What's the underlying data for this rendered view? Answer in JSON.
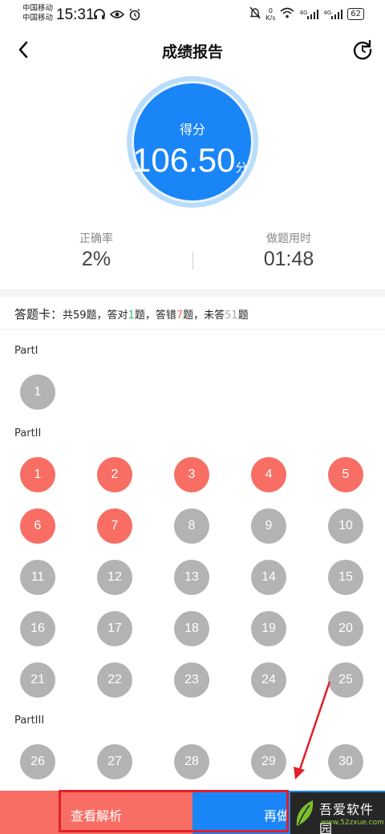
{
  "status_bar": {
    "carrier_1": "中国移动",
    "carrier_2": "中国移动",
    "time": "15:31",
    "speed_value": "0",
    "speed_unit": "K/s",
    "signal_1": "4G",
    "signal_2": "4G",
    "battery": "62"
  },
  "header": {
    "title": "成绩报告",
    "back_icon": "chevron-left-icon",
    "refresh_icon": "redo-icon"
  },
  "score": {
    "label": "得分",
    "value": "106.50",
    "unit": "分"
  },
  "stats": {
    "accuracy_label": "正确率",
    "accuracy_value": "2%",
    "time_label": "做题用时",
    "time_value": "01:48"
  },
  "answer_card": {
    "title": "答题卡：",
    "total_prefix": "共59题，答对",
    "correct": "1",
    "mid1": "题，答错",
    "wrong": "7",
    "mid2": "题，未答",
    "blank": "51",
    "suffix": "题"
  },
  "parts": [
    {
      "name": "PartI",
      "questions": [
        {
          "n": "1",
          "status": "unanswered"
        }
      ]
    },
    {
      "name": "PartII",
      "questions": [
        {
          "n": "1",
          "status": "wrong"
        },
        {
          "n": "2",
          "status": "wrong"
        },
        {
          "n": "3",
          "status": "wrong"
        },
        {
          "n": "4",
          "status": "wrong"
        },
        {
          "n": "5",
          "status": "wrong"
        },
        {
          "n": "6",
          "status": "wrong"
        },
        {
          "n": "7",
          "status": "wrong"
        },
        {
          "n": "8",
          "status": "unanswered"
        },
        {
          "n": "9",
          "status": "unanswered"
        },
        {
          "n": "10",
          "status": "unanswered"
        },
        {
          "n": "11",
          "status": "unanswered"
        },
        {
          "n": "12",
          "status": "unanswered"
        },
        {
          "n": "13",
          "status": "unanswered"
        },
        {
          "n": "14",
          "status": "unanswered"
        },
        {
          "n": "15",
          "status": "unanswered"
        },
        {
          "n": "16",
          "status": "unanswered"
        },
        {
          "n": "17",
          "status": "unanswered"
        },
        {
          "n": "18",
          "status": "unanswered"
        },
        {
          "n": "19",
          "status": "unanswered"
        },
        {
          "n": "20",
          "status": "unanswered"
        },
        {
          "n": "21",
          "status": "unanswered"
        },
        {
          "n": "22",
          "status": "unanswered"
        },
        {
          "n": "23",
          "status": "unanswered"
        },
        {
          "n": "24",
          "status": "unanswered"
        },
        {
          "n": "25",
          "status": "unanswered"
        }
      ]
    },
    {
      "name": "PartIII",
      "questions": [
        {
          "n": "26",
          "status": "unanswered"
        },
        {
          "n": "27",
          "status": "unanswered"
        },
        {
          "n": "28",
          "status": "unanswered"
        },
        {
          "n": "29",
          "status": "unanswered"
        },
        {
          "n": "30",
          "status": "unanswered"
        }
      ]
    }
  ],
  "bottom": {
    "analysis_label": "查看解析",
    "redo_label": "再做"
  },
  "watermark": {
    "text": "吾爱软件园",
    "url": "www.52zxue.com"
  },
  "colors": {
    "primary": "#1a85f6",
    "wrong": "#f86e64",
    "unanswered": "#b3b3b3",
    "correct": "#2fbf6a",
    "annotation": "#e0202a"
  }
}
